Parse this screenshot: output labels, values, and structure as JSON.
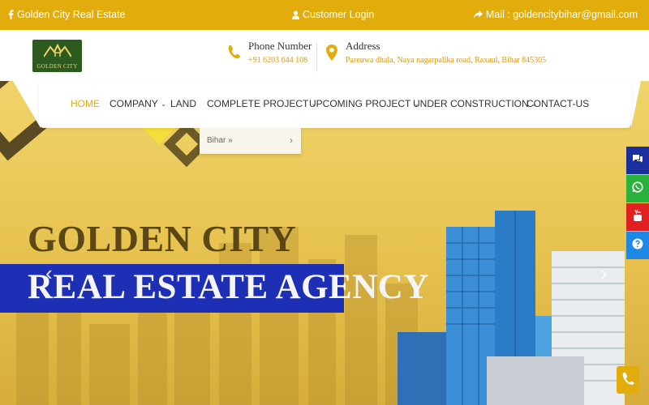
{
  "topbar": {
    "brand": "Golden City Real Estate",
    "login": "Customer Login",
    "mail": "Mail : goldencitybihar@gmail.com"
  },
  "logo": {
    "text": "GOLDEN CITY"
  },
  "phone": {
    "title": "Phone Number",
    "value": "+91 6203 644 108"
  },
  "address": {
    "title": "Address",
    "value": "Pareuwa dhala, Naya nagarpalika road, Raxaul, Bihar 845305"
  },
  "nav": {
    "items": [
      {
        "label": "HOME",
        "active": true
      },
      {
        "label": "COMPANY"
      },
      {
        "label": "LAND"
      },
      {
        "label": "COMPLETE PROJECT"
      },
      {
        "label": "UPCOMING PROJECT"
      },
      {
        "label": "UNDER CONSTRUCTION"
      },
      {
        "label": "CONTACT-US"
      }
    ],
    "dropdown_item": "Bihar »"
  },
  "hero": {
    "headline_1": "GOLDEN CITY",
    "headline_2": "REAL ESTATE AGENCY",
    "prev": "‹",
    "next": "›"
  },
  "colors": {
    "accent": "#e2ad0c",
    "band": "#1d2fb4",
    "logo_bg": "#2d5a1e"
  },
  "icons": [
    "facebook-icon",
    "user-icon",
    "share-icon",
    "phone-icon",
    "map-pin-icon",
    "chat-icon",
    "whatsapp-icon",
    "youtube-icon",
    "help-icon",
    "call-icon"
  ]
}
